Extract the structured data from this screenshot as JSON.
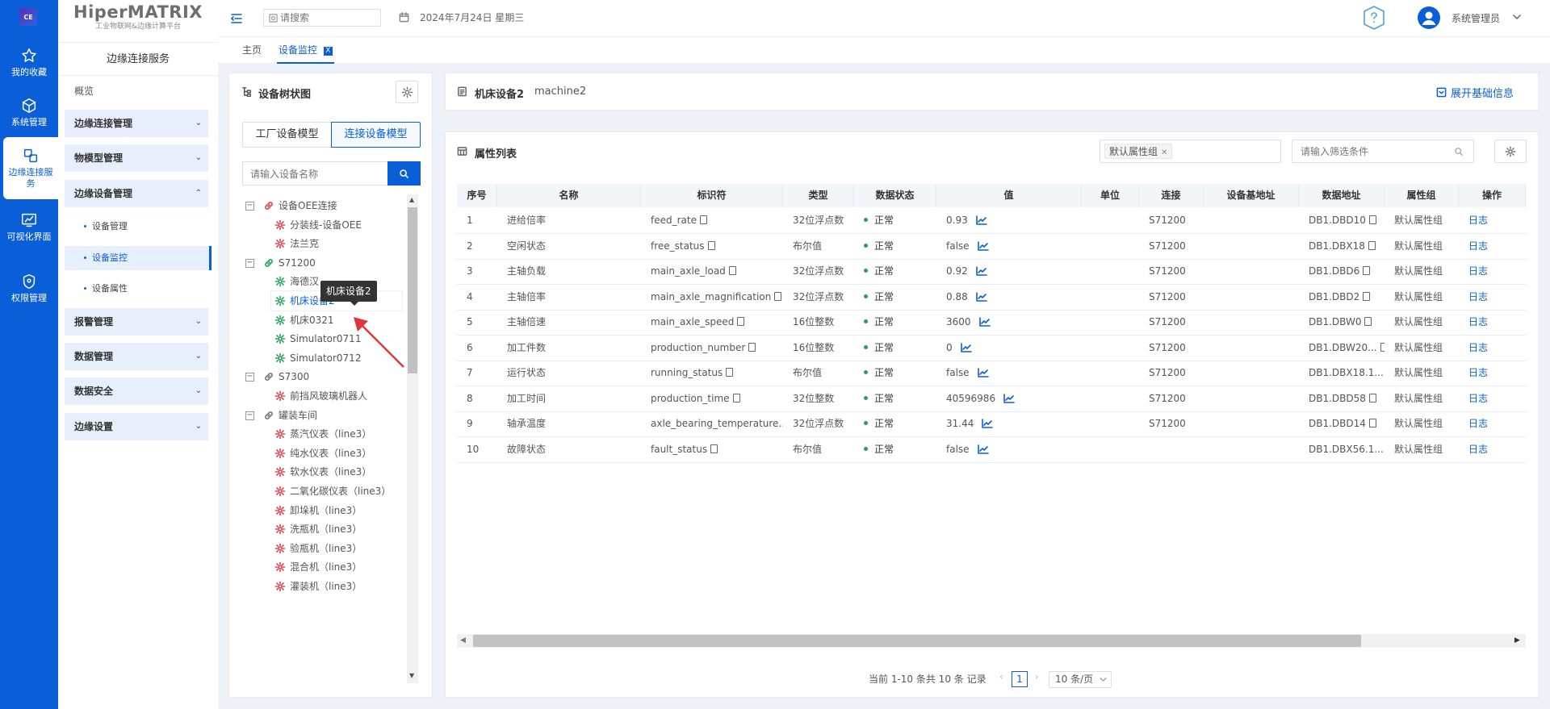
{
  "rail": {
    "logo": "CE",
    "items": [
      {
        "label": "我的收藏",
        "icon": "star-icon"
      },
      {
        "label": "系统管理",
        "icon": "cube-icon"
      },
      {
        "label": "边缘连接服务",
        "icon": "edge-service-icon"
      },
      {
        "label": "可视化界面",
        "icon": "screen-chart-icon"
      },
      {
        "label": "权限管理",
        "icon": "shield-icon"
      }
    ]
  },
  "brand": {
    "title": "HiperMATRIX",
    "subtitle": "工业物联网&边缘计算平台"
  },
  "sidebar": {
    "service_title": "边缘连接服务",
    "overview": "概览",
    "groups": [
      {
        "label": "边缘连接管理",
        "chev": "⌄"
      },
      {
        "label": "物模型管理",
        "chev": "⌄"
      },
      {
        "label": "边缘设备管理",
        "chev": "⌃"
      },
      {
        "label": "报警管理",
        "chev": "⌄"
      },
      {
        "label": "数据管理",
        "chev": "⌄"
      },
      {
        "label": "数据安全",
        "chev": "⌄"
      },
      {
        "label": "边缘设置",
        "chev": "⌄"
      }
    ],
    "sub_items": [
      "设备管理",
      "设备监控",
      "设备属性"
    ]
  },
  "topbar": {
    "search_placeholder": "请搜索",
    "date": "2024年7月24日 星期三",
    "user": "系统管理员"
  },
  "tabs": {
    "home": "主页",
    "current": "设备监控",
    "close": "X"
  },
  "tree": {
    "title": "设备树状图",
    "tab_factory": "工厂设备模型",
    "tab_connect": "连接设备模型",
    "search_placeholder": "请输入设备名称",
    "tooltip": "机床设备2",
    "nodes": [
      {
        "label": "设备OEE连接",
        "level": 0,
        "icon": "link-red"
      },
      {
        "label": "分装线-设备OEE",
        "level": 1,
        "icon": "gear-red"
      },
      {
        "label": "法兰克",
        "level": 1,
        "icon": "gear-red"
      },
      {
        "label": "S71200",
        "level": 0,
        "icon": "link-green"
      },
      {
        "label": "海德汉",
        "level": 1,
        "icon": "gear-green"
      },
      {
        "label": "机床设备2",
        "level": 1,
        "icon": "gear-green"
      },
      {
        "label": "机床0321",
        "level": 1,
        "icon": "gear-green"
      },
      {
        "label": "Simulator0711",
        "level": 1,
        "icon": "gear-green"
      },
      {
        "label": "Simulator0712",
        "level": 1,
        "icon": "gear-green"
      },
      {
        "label": "S7300",
        "level": 0,
        "icon": "link-gray"
      },
      {
        "label": "前挡风玻璃机器人",
        "level": 1,
        "icon": "gear-red"
      },
      {
        "label": "罐装车间",
        "level": 0,
        "icon": "link-gray"
      },
      {
        "label": "蒸汽仪表（line3）",
        "level": 1,
        "icon": "gear-red"
      },
      {
        "label": "纯水仪表（line3）",
        "level": 1,
        "icon": "gear-red"
      },
      {
        "label": "软水仪表（line3）",
        "level": 1,
        "icon": "gear-red"
      },
      {
        "label": "二氧化碳仪表（line3）",
        "level": 1,
        "icon": "gear-red"
      },
      {
        "label": "卸垛机（line3）",
        "level": 1,
        "icon": "gear-red"
      },
      {
        "label": "洗瓶机（line3）",
        "level": 1,
        "icon": "gear-red"
      },
      {
        "label": "验瓶机（line3）",
        "level": 1,
        "icon": "gear-red"
      },
      {
        "label": "混合机（line3）",
        "level": 1,
        "icon": "gear-red"
      },
      {
        "label": "灌装机（line3）",
        "level": 1,
        "icon": "gear-red"
      }
    ]
  },
  "device": {
    "name": "机床设备2",
    "code": "machine2",
    "expand_label": "展开基础信息"
  },
  "props": {
    "title": "属性列表",
    "filter_tag": "默认属性组",
    "filter_placeholder": "请输入筛选条件",
    "columns": [
      "序号",
      "名称",
      "标识符",
      "类型",
      "数据状态",
      "值",
      "单位",
      "连接",
      "设备基地址",
      "数据地址",
      "属性组",
      "操作"
    ],
    "rows": [
      [
        "1",
        "进给倍率",
        "feed_rate",
        "32位浮点数",
        "正常",
        "0.93",
        "",
        "S71200",
        "",
        "DB1.DBD10",
        "默认属性组",
        "日志"
      ],
      [
        "2",
        "空闲状态",
        "free_status",
        "布尔值",
        "正常",
        "false",
        "",
        "S71200",
        "",
        "DB1.DBX18",
        "默认属性组",
        "日志"
      ],
      [
        "3",
        "主轴负载",
        "main_axle_load",
        "32位浮点数",
        "正常",
        "0.92",
        "",
        "S71200",
        "",
        "DB1.DBD6",
        "默认属性组",
        "日志"
      ],
      [
        "4",
        "主轴倍率",
        "main_axle_magnification",
        "32位浮点数",
        "正常",
        "0.88",
        "",
        "S71200",
        "",
        "DB1.DBD2",
        "默认属性组",
        "日志"
      ],
      [
        "5",
        "主轴倍速",
        "main_axle_speed",
        "16位整数",
        "正常",
        "3600",
        "",
        "S71200",
        "",
        "DB1.DBW0",
        "默认属性组",
        "日志"
      ],
      [
        "6",
        "加工件数",
        "production_number",
        "16位整数",
        "正常",
        "0",
        "",
        "S71200",
        "",
        "DB1.DBW20...",
        "默认属性组",
        "日志"
      ],
      [
        "7",
        "运行状态",
        "running_status",
        "布尔值",
        "正常",
        "false",
        "",
        "S71200",
        "",
        "DB1.DBX18.1...",
        "默认属性组",
        "日志"
      ],
      [
        "8",
        "加工时间",
        "production_time",
        "32位整数",
        "正常",
        "40596986",
        "",
        "S71200",
        "",
        "DB1.DBD58",
        "默认属性组",
        "日志"
      ],
      [
        "9",
        "轴承温度",
        "axle_bearing_temperature...",
        "32位浮点数",
        "正常",
        "31.44",
        "",
        "S71200",
        "",
        "DB1.DBD14",
        "默认属性组",
        "日志"
      ],
      [
        "10",
        "故障状态",
        "fault_status",
        "布尔值",
        "正常",
        "false",
        "",
        "",
        "",
        "DB1.DBX56.1...",
        "默认属性组",
        "日志"
      ]
    ]
  },
  "pagination": {
    "summary": "当前 1-10 条共 10 条 记录",
    "page": "1",
    "page_size": "10 条/页"
  },
  "colors": {
    "primary": "#0a5fd8",
    "ok": "#21a35b",
    "danger": "#e0424a"
  }
}
